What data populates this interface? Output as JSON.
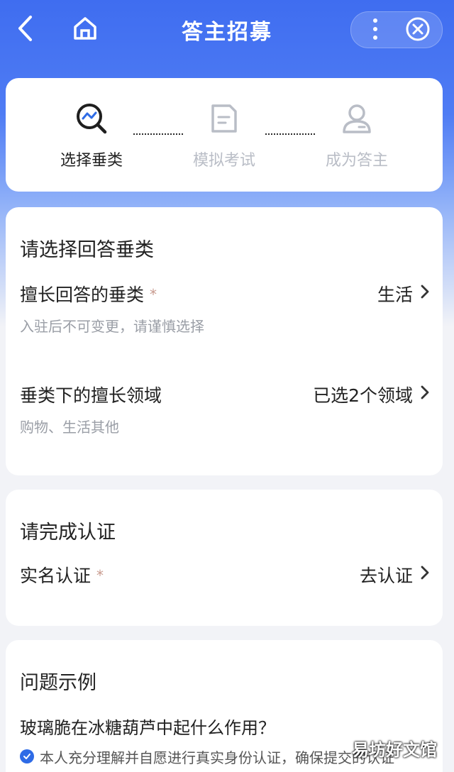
{
  "header": {
    "title": "答主招募",
    "back_icon": "chevron-left-icon",
    "home_icon": "home-icon",
    "more_icon": "more-vertical-icon",
    "close_icon": "close-circle-icon"
  },
  "steps": [
    {
      "label": "选择垂类",
      "icon": "search-chart-icon",
      "state": "active"
    },
    {
      "label": "模拟考试",
      "icon": "document-icon",
      "state": "inactive"
    },
    {
      "label": "成为答主",
      "icon": "user-icon",
      "state": "inactive"
    }
  ],
  "category_section": {
    "title": "请选择回答垂类",
    "rows": [
      {
        "label": "擅长回答的垂类",
        "required_mark": "*",
        "value": "生活",
        "hint": "入驻后不可变更，请谨慎选择"
      },
      {
        "label": "垂类下的擅长领域",
        "value": "已选2个领域",
        "hint": "购物、生活其他"
      }
    ]
  },
  "auth_section": {
    "title": "请完成认证",
    "row": {
      "label": "实名认证",
      "required_mark": "*",
      "value": "去认证"
    }
  },
  "example_section": {
    "title": "问题示例",
    "question": "玻璃脆在冰糖葫芦中起什么作用？"
  },
  "agreement": {
    "checked": true,
    "text": "本人充分理解并自愿进行真实身份认证，确保提交的认证"
  },
  "watermark": "易坊好文馆",
  "colors": {
    "accent": "#2e6be6",
    "header_gradient_top": "#3f6df0",
    "inactive_text": "#b9bdc6",
    "hint_text": "#9a9ea6",
    "required_star": "#c89a8e"
  }
}
